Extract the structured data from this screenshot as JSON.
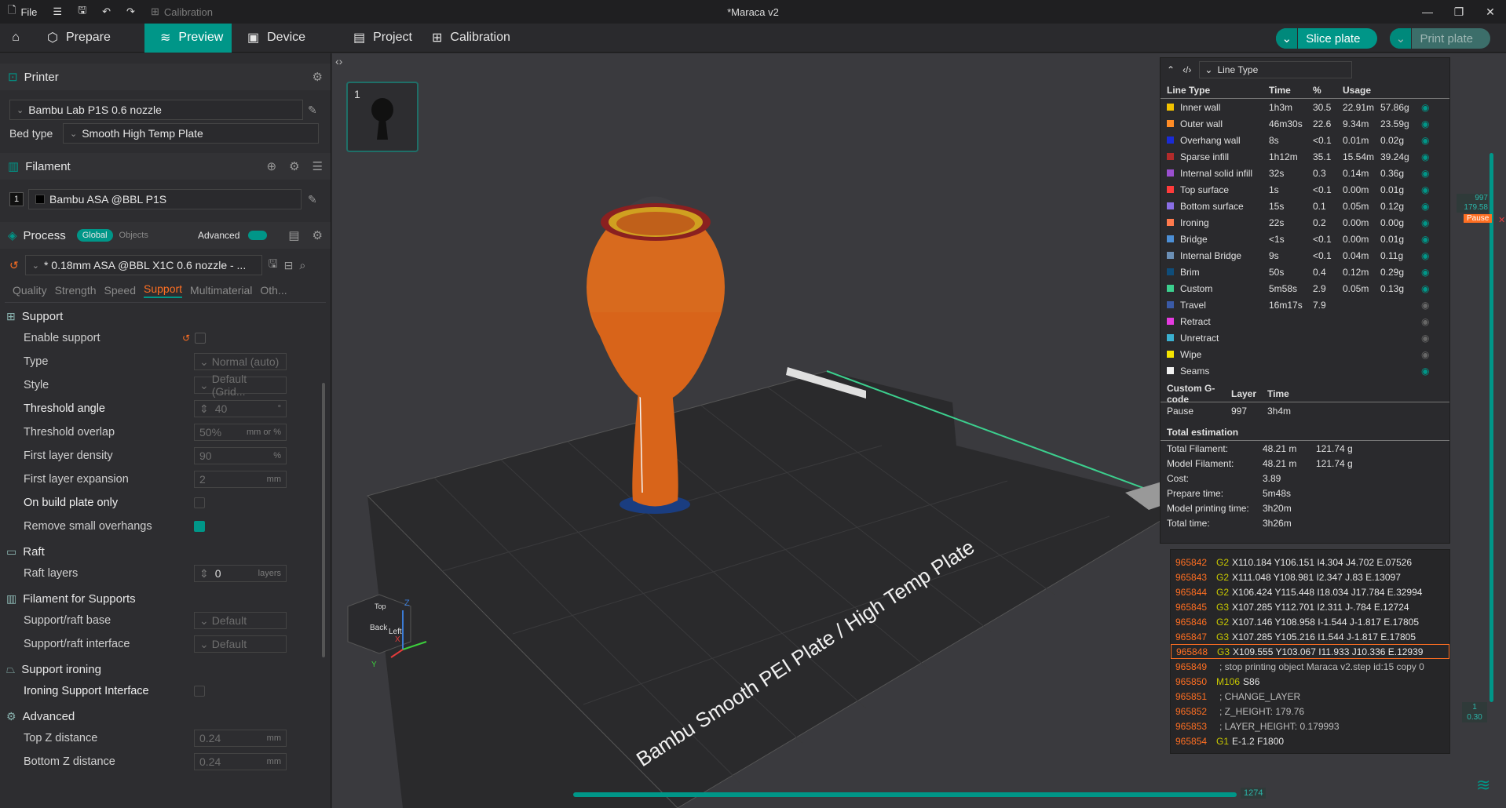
{
  "titlebar": {
    "file_label": "File",
    "calibration_label": "Calibration",
    "window_title": "*Maraca v2"
  },
  "menubar": {
    "tabs": [
      {
        "label": "Prepare"
      },
      {
        "label": "Preview"
      },
      {
        "label": "Device"
      },
      {
        "label": "Project"
      },
      {
        "label": "Calibration"
      }
    ],
    "slice_label": "Slice plate",
    "print_label": "Print plate"
  },
  "printer": {
    "section_label": "Printer",
    "printer_name": "Bambu Lab P1S 0.6 nozzle",
    "bed_type_label": "Bed type",
    "bed_type_value": "Smooth High Temp Plate"
  },
  "filament": {
    "section_label": "Filament",
    "slot_number": "1",
    "name": "Bambu ASA @BBL P1S"
  },
  "process": {
    "section_label": "Process",
    "global_label": "Global",
    "objects_label": "Objects",
    "advanced_label": "Advanced",
    "profile": "* 0.18mm ASA @BBL X1C 0.6 nozzle - ...",
    "subtabs": [
      "Quality",
      "Strength",
      "Speed",
      "Support",
      "Multimaterial",
      "Oth..."
    ]
  },
  "support": {
    "group_label": "Support",
    "enable_label": "Enable support",
    "type_label": "Type",
    "type_value": "Normal (auto)",
    "style_label": "Style",
    "style_value": "Default (Grid...",
    "threshold_angle_label": "Threshold angle",
    "threshold_angle_value": "40",
    "threshold_angle_unit": "°",
    "threshold_overlap_label": "Threshold overlap",
    "threshold_overlap_value": "50%",
    "threshold_overlap_unit": "mm or %",
    "first_layer_density_label": "First layer density",
    "first_layer_density_value": "90",
    "first_layer_density_unit": "%",
    "first_layer_expansion_label": "First layer expansion",
    "first_layer_expansion_value": "2",
    "first_layer_expansion_unit": "mm",
    "build_plate_only_label": "On build plate only",
    "remove_small_label": "Remove small overhangs"
  },
  "raft": {
    "group_label": "Raft",
    "layers_label": "Raft layers",
    "layers_value": "0",
    "layers_unit": "layers"
  },
  "filament_supports": {
    "group_label": "Filament for Supports",
    "base_label": "Support/raft base",
    "base_value": "Default",
    "interface_label": "Support/raft interface",
    "interface_value": "Default"
  },
  "support_ironing": {
    "group_label": "Support ironing",
    "interface_label": "Ironing Support Interface"
  },
  "advanced": {
    "group_label": "Advanced",
    "top_z_label": "Top Z distance",
    "top_z_value": "0.24",
    "bottom_z_label": "Bottom Z distance",
    "bottom_z_value": "0.24",
    "unit": "mm"
  },
  "viewport": {
    "plate_number": "1",
    "plate_text": "Bambu Smooth PEI Plate / High Temp Plate",
    "cube_back": "Back",
    "cube_left": "Left",
    "cube_top": "Top",
    "axis_z": "Z",
    "axis_x": "X",
    "axis_y": "Y"
  },
  "legend": {
    "selector_label": "Line Type",
    "headers": {
      "type": "Line Type",
      "time": "Time",
      "pct": "%",
      "usage": "Usage"
    },
    "rows": [
      {
        "name": "Inner wall",
        "color": "#f2c200",
        "time": "1h3m",
        "pct": "30.5",
        "len": "22.91m",
        "wt": "57.86g",
        "visible": true
      },
      {
        "name": "Outer wall",
        "color": "#ff8c26",
        "time": "46m30s",
        "pct": "22.6",
        "len": "9.34m",
        "wt": "23.59g",
        "visible": true
      },
      {
        "name": "Overhang wall",
        "color": "#1a2bd6",
        "time": "8s",
        "pct": "<0.1",
        "len": "0.01m",
        "wt": "0.02g",
        "visible": true
      },
      {
        "name": "Sparse infill",
        "color": "#b22b2b",
        "time": "1h12m",
        "pct": "35.1",
        "len": "15.54m",
        "wt": "39.24g",
        "visible": true
      },
      {
        "name": "Internal solid infill",
        "color": "#9b4fcf",
        "time": "32s",
        "pct": "0.3",
        "len": "0.14m",
        "wt": "0.36g",
        "visible": true
      },
      {
        "name": "Top surface",
        "color": "#ff3b3b",
        "time": "1s",
        "pct": "<0.1",
        "len": "0.00m",
        "wt": "0.01g",
        "visible": true
      },
      {
        "name": "Bottom surface",
        "color": "#8a6ee6",
        "time": "15s",
        "pct": "0.1",
        "len": "0.05m",
        "wt": "0.12g",
        "visible": true
      },
      {
        "name": "Ironing",
        "color": "#ff7a4d",
        "time": "22s",
        "pct": "0.2",
        "len": "0.00m",
        "wt": "0.00g",
        "visible": true
      },
      {
        "name": "Bridge",
        "color": "#4c8fd6",
        "time": "<1s",
        "pct": "<0.1",
        "len": "0.00m",
        "wt": "0.01g",
        "visible": true
      },
      {
        "name": "Internal Bridge",
        "color": "#6b8fb5",
        "time": "9s",
        "pct": "<0.1",
        "len": "0.04m",
        "wt": "0.11g",
        "visible": true
      },
      {
        "name": "Brim",
        "color": "#0f4d7a",
        "time": "50s",
        "pct": "0.4",
        "len": "0.12m",
        "wt": "0.29g",
        "visible": true
      },
      {
        "name": "Custom",
        "color": "#3ccf8e",
        "time": "5m58s",
        "pct": "2.9",
        "len": "0.05m",
        "wt": "0.13g",
        "visible": true
      },
      {
        "name": "Travel",
        "color": "#3a5aa6",
        "time": "16m17s",
        "pct": "7.9",
        "len": "",
        "wt": "",
        "visible": false
      },
      {
        "name": "Retract",
        "color": "#e53be0",
        "time": "",
        "pct": "",
        "len": "",
        "wt": "",
        "visible": false
      },
      {
        "name": "Unretract",
        "color": "#3bb0cf",
        "time": "",
        "pct": "",
        "len": "",
        "wt": "",
        "visible": false
      },
      {
        "name": "Wipe",
        "color": "#f5e400",
        "time": "",
        "pct": "",
        "len": "",
        "wt": "",
        "visible": false
      },
      {
        "name": "Seams",
        "color": "#f0f0f0",
        "time": "",
        "pct": "",
        "len": "",
        "wt": "",
        "visible": true
      }
    ],
    "custom_gcode_headers": {
      "a": "Custom G-code",
      "b": "Layer",
      "c": "Time"
    },
    "custom_gcode": {
      "name": "Pause",
      "layer": "997",
      "time": "3h4m"
    },
    "total_label": "Total estimation",
    "totals": [
      {
        "k": "Total Filament:",
        "a": "48.21 m",
        "b": "121.74 g"
      },
      {
        "k": "Model Filament:",
        "a": "48.21 m",
        "b": "121.74 g"
      },
      {
        "k": "Cost:",
        "a": "3.89",
        "b": ""
      },
      {
        "k": "Prepare time:",
        "a": "5m48s",
        "b": ""
      },
      {
        "k": "Model printing time:",
        "a": "3h20m",
        "b": ""
      },
      {
        "k": "Total time:",
        "a": "3h26m",
        "b": ""
      }
    ]
  },
  "gcode": [
    {
      "n": "965842",
      "cmd": "G2",
      "args": "X110.184 Y106.151 I4.304 J4.702 E.07526"
    },
    {
      "n": "965843",
      "cmd": "G2",
      "args": "X111.048 Y108.981 I2.347 J.83 E.13097"
    },
    {
      "n": "965844",
      "cmd": "G2",
      "args": "X106.424 Y115.448 I18.034 J17.784 E.32994"
    },
    {
      "n": "965845",
      "cmd": "G3",
      "args": "X107.285 Y112.701 I2.311 J-.784 E.12724"
    },
    {
      "n": "965846",
      "cmd": "G2",
      "args": "X107.146 Y108.958 I-1.544 J-1.817 E.17805"
    },
    {
      "n": "965847",
      "cmd": "G3",
      "args": "X107.285 Y105.216 I1.544 J-1.817 E.17805"
    },
    {
      "n": "965848",
      "cmd": "G3",
      "args": "X109.555 Y103.067 I11.933 J10.336 E.12939"
    },
    {
      "n": "965849",
      "cmd": "",
      "args": "; stop printing object Maraca v2.step id:15 copy 0"
    },
    {
      "n": "965850",
      "cmd": "M106",
      "args": "S86"
    },
    {
      "n": "965851",
      "cmd": "",
      "args": "; CHANGE_LAYER"
    },
    {
      "n": "965852",
      "cmd": "",
      "args": "; Z_HEIGHT: 179.76"
    },
    {
      "n": "965853",
      "cmd": "",
      "args": "; LAYER_HEIGHT: 0.179993"
    },
    {
      "n": "965854",
      "cmd": "G1",
      "args": "E-1.2 F1800"
    }
  ],
  "sliders": {
    "top_layer": "997",
    "top_height": "179.58",
    "pause_label": "Pause",
    "bottom_layer": "1",
    "bottom_height": "0.30",
    "horizontal_value": "1274"
  }
}
